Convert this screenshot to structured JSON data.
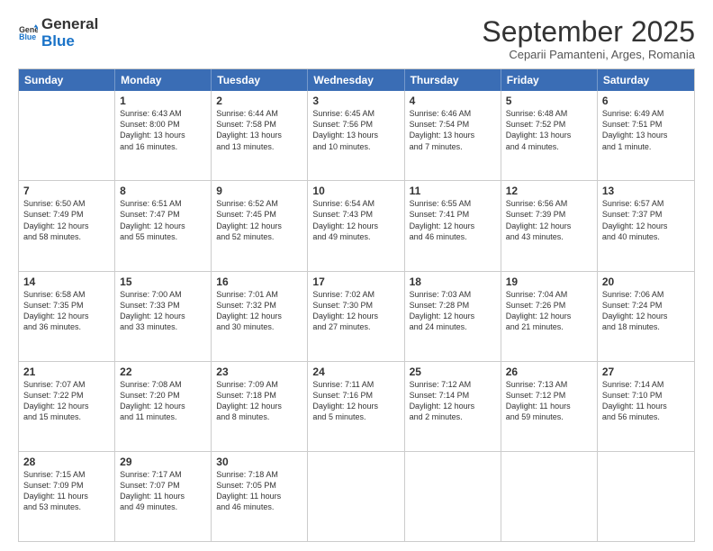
{
  "header": {
    "logo_line1": "General",
    "logo_line2": "Blue",
    "month": "September 2025",
    "location": "Ceparii Pamanteni, Arges, Romania"
  },
  "days_of_week": [
    "Sunday",
    "Monday",
    "Tuesday",
    "Wednesday",
    "Thursday",
    "Friday",
    "Saturday"
  ],
  "weeks": [
    [
      {
        "day": "",
        "info": ""
      },
      {
        "day": "1",
        "info": "Sunrise: 6:43 AM\nSunset: 8:00 PM\nDaylight: 13 hours\nand 16 minutes."
      },
      {
        "day": "2",
        "info": "Sunrise: 6:44 AM\nSunset: 7:58 PM\nDaylight: 13 hours\nand 13 minutes."
      },
      {
        "day": "3",
        "info": "Sunrise: 6:45 AM\nSunset: 7:56 PM\nDaylight: 13 hours\nand 10 minutes."
      },
      {
        "day": "4",
        "info": "Sunrise: 6:46 AM\nSunset: 7:54 PM\nDaylight: 13 hours\nand 7 minutes."
      },
      {
        "day": "5",
        "info": "Sunrise: 6:48 AM\nSunset: 7:52 PM\nDaylight: 13 hours\nand 4 minutes."
      },
      {
        "day": "6",
        "info": "Sunrise: 6:49 AM\nSunset: 7:51 PM\nDaylight: 13 hours\nand 1 minute."
      }
    ],
    [
      {
        "day": "7",
        "info": "Sunrise: 6:50 AM\nSunset: 7:49 PM\nDaylight: 12 hours\nand 58 minutes."
      },
      {
        "day": "8",
        "info": "Sunrise: 6:51 AM\nSunset: 7:47 PM\nDaylight: 12 hours\nand 55 minutes."
      },
      {
        "day": "9",
        "info": "Sunrise: 6:52 AM\nSunset: 7:45 PM\nDaylight: 12 hours\nand 52 minutes."
      },
      {
        "day": "10",
        "info": "Sunrise: 6:54 AM\nSunset: 7:43 PM\nDaylight: 12 hours\nand 49 minutes."
      },
      {
        "day": "11",
        "info": "Sunrise: 6:55 AM\nSunset: 7:41 PM\nDaylight: 12 hours\nand 46 minutes."
      },
      {
        "day": "12",
        "info": "Sunrise: 6:56 AM\nSunset: 7:39 PM\nDaylight: 12 hours\nand 43 minutes."
      },
      {
        "day": "13",
        "info": "Sunrise: 6:57 AM\nSunset: 7:37 PM\nDaylight: 12 hours\nand 40 minutes."
      }
    ],
    [
      {
        "day": "14",
        "info": "Sunrise: 6:58 AM\nSunset: 7:35 PM\nDaylight: 12 hours\nand 36 minutes."
      },
      {
        "day": "15",
        "info": "Sunrise: 7:00 AM\nSunset: 7:33 PM\nDaylight: 12 hours\nand 33 minutes."
      },
      {
        "day": "16",
        "info": "Sunrise: 7:01 AM\nSunset: 7:32 PM\nDaylight: 12 hours\nand 30 minutes."
      },
      {
        "day": "17",
        "info": "Sunrise: 7:02 AM\nSunset: 7:30 PM\nDaylight: 12 hours\nand 27 minutes."
      },
      {
        "day": "18",
        "info": "Sunrise: 7:03 AM\nSunset: 7:28 PM\nDaylight: 12 hours\nand 24 minutes."
      },
      {
        "day": "19",
        "info": "Sunrise: 7:04 AM\nSunset: 7:26 PM\nDaylight: 12 hours\nand 21 minutes."
      },
      {
        "day": "20",
        "info": "Sunrise: 7:06 AM\nSunset: 7:24 PM\nDaylight: 12 hours\nand 18 minutes."
      }
    ],
    [
      {
        "day": "21",
        "info": "Sunrise: 7:07 AM\nSunset: 7:22 PM\nDaylight: 12 hours\nand 15 minutes."
      },
      {
        "day": "22",
        "info": "Sunrise: 7:08 AM\nSunset: 7:20 PM\nDaylight: 12 hours\nand 11 minutes."
      },
      {
        "day": "23",
        "info": "Sunrise: 7:09 AM\nSunset: 7:18 PM\nDaylight: 12 hours\nand 8 minutes."
      },
      {
        "day": "24",
        "info": "Sunrise: 7:11 AM\nSunset: 7:16 PM\nDaylight: 12 hours\nand 5 minutes."
      },
      {
        "day": "25",
        "info": "Sunrise: 7:12 AM\nSunset: 7:14 PM\nDaylight: 12 hours\nand 2 minutes."
      },
      {
        "day": "26",
        "info": "Sunrise: 7:13 AM\nSunset: 7:12 PM\nDaylight: 11 hours\nand 59 minutes."
      },
      {
        "day": "27",
        "info": "Sunrise: 7:14 AM\nSunset: 7:10 PM\nDaylight: 11 hours\nand 56 minutes."
      }
    ],
    [
      {
        "day": "28",
        "info": "Sunrise: 7:15 AM\nSunset: 7:09 PM\nDaylight: 11 hours\nand 53 minutes."
      },
      {
        "day": "29",
        "info": "Sunrise: 7:17 AM\nSunset: 7:07 PM\nDaylight: 11 hours\nand 49 minutes."
      },
      {
        "day": "30",
        "info": "Sunrise: 7:18 AM\nSunset: 7:05 PM\nDaylight: 11 hours\nand 46 minutes."
      },
      {
        "day": "",
        "info": ""
      },
      {
        "day": "",
        "info": ""
      },
      {
        "day": "",
        "info": ""
      },
      {
        "day": "",
        "info": ""
      }
    ]
  ]
}
